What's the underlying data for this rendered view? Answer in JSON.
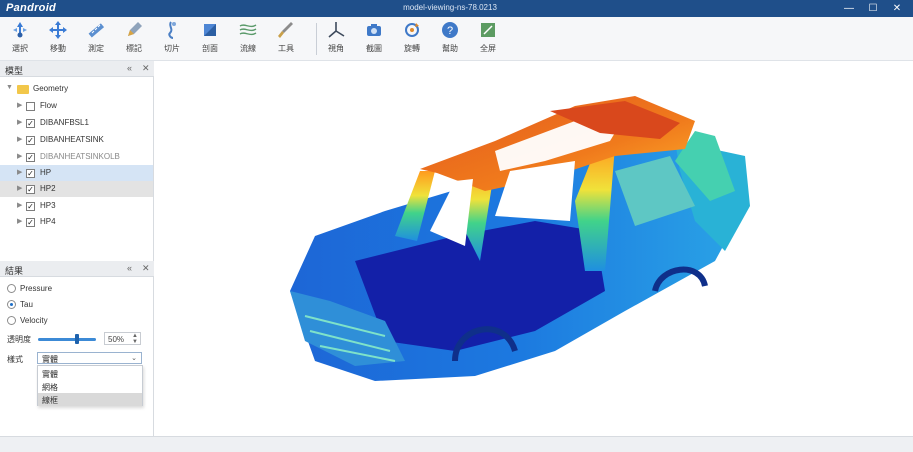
{
  "app": {
    "name": "Pandroid",
    "document_title": "model-viewing-ns-78.0213"
  },
  "window_controls": {
    "minimize": "—",
    "maximize": "☐",
    "close": "✕"
  },
  "toolbar": {
    "tools": [
      {
        "label": "選択",
        "icon": "select-icon"
      },
      {
        "label": "移動",
        "icon": "move-icon"
      },
      {
        "label": "測定",
        "icon": "measure-icon"
      },
      {
        "label": "標記",
        "icon": "annotate-icon"
      },
      {
        "label": "切片",
        "icon": "section-icon"
      },
      {
        "label": "剖面",
        "icon": "clip-icon"
      },
      {
        "label": "流線",
        "icon": "streamline-icon"
      },
      {
        "label": "工具",
        "icon": "tools-icon"
      },
      {
        "label": "視角",
        "icon": "axes-icon"
      },
      {
        "label": "截圖",
        "icon": "camera-icon"
      },
      {
        "label": "旋轉",
        "icon": "rotate-icon"
      },
      {
        "label": "幫助",
        "icon": "help-icon"
      },
      {
        "label": "全屏",
        "icon": "fullscreen-icon"
      }
    ]
  },
  "model_panel": {
    "title": "模型",
    "root": "Geometry",
    "items": [
      {
        "label": "Flow",
        "checked": false
      },
      {
        "label": "DIBANFBSL1",
        "checked": true
      },
      {
        "label": "DIBANHEATSINK",
        "checked": true
      },
      {
        "label": "DIBANHEATSINKOLB",
        "checked": true
      },
      {
        "label": "HP",
        "checked": true
      },
      {
        "label": "HP2",
        "checked": true
      },
      {
        "label": "HP3",
        "checked": true
      },
      {
        "label": "HP4",
        "checked": true
      }
    ]
  },
  "result_panel": {
    "title": "結果",
    "fields": [
      {
        "label": "Pressure",
        "selected": false
      },
      {
        "label": "Tau",
        "selected": true
      },
      {
        "label": "Velocity",
        "selected": false
      }
    ],
    "transparency_label": "透明度",
    "transparency_value": "50%",
    "transparency_fraction": 0.65,
    "style_label": "樣式",
    "style_value": "實體",
    "style_options": [
      "實體",
      "網格",
      "線框"
    ],
    "highlighted_option": 2
  },
  "colors": {
    "titlebar": "#1f4f8a",
    "accent": "#1e6fc8",
    "selection": "#d5e4f5"
  }
}
